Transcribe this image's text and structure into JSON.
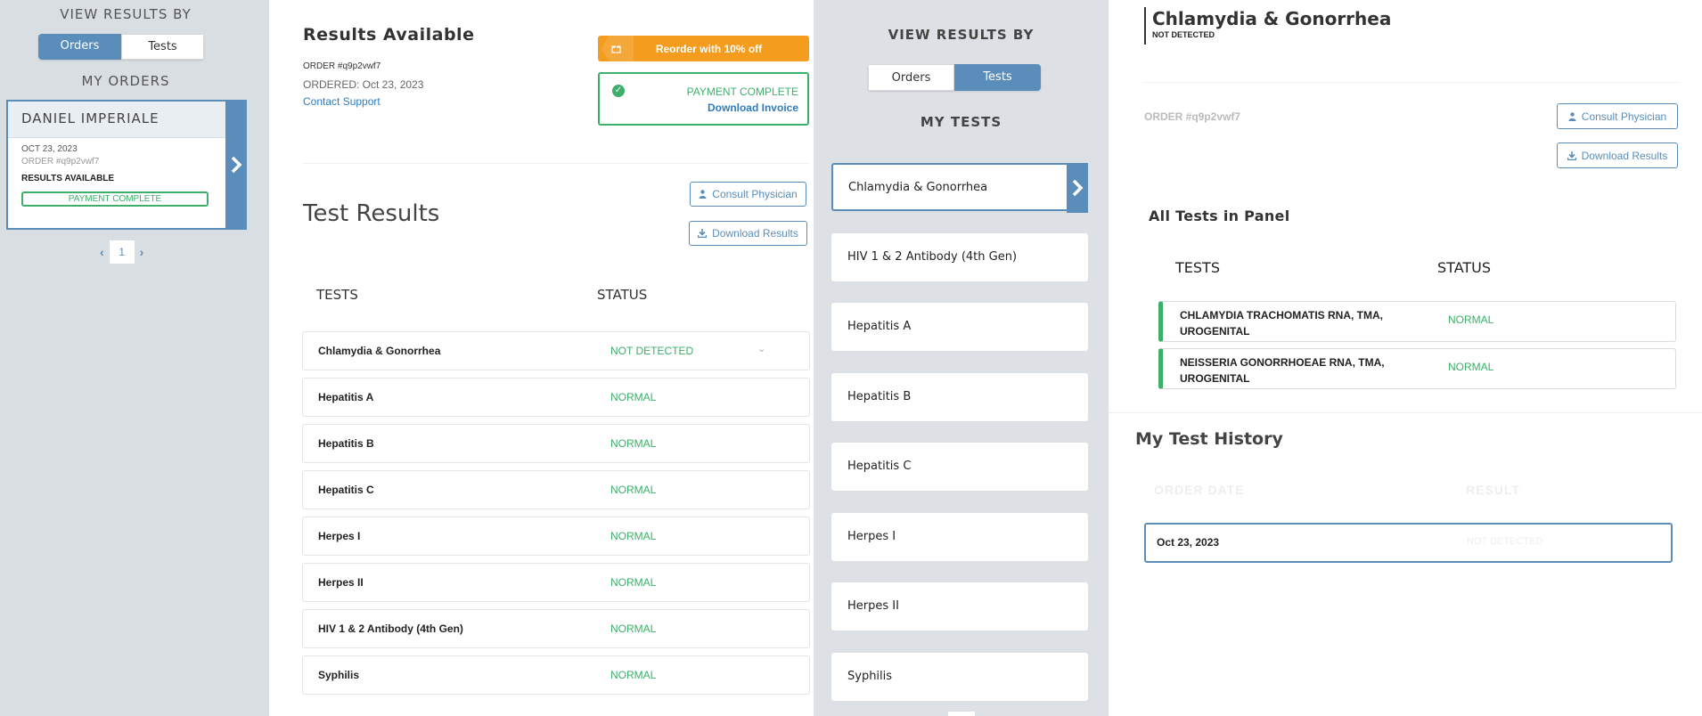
{
  "orders_panel": {
    "view_results_by": "VIEW RESULTS BY",
    "toggle": {
      "orders": "Orders",
      "tests": "Tests"
    },
    "my_orders": "MY ORDERS",
    "order_card": {
      "name": "DANIEL IMPERIALE",
      "date": "OCT 23, 2023",
      "order_number": "ORDER #q9p2vwf7",
      "status": "RESULTS AVAILABLE",
      "payment": "PAYMENT COMPLETE"
    },
    "pager": {
      "page": "1"
    }
  },
  "results_panel": {
    "title": "Results Available",
    "order_number": "ORDER #q9p2vwf7",
    "ordered": "ORDERED: Oct 23, 2023",
    "contact_support": "Contact Support",
    "reorder": "Reorder with 10% off",
    "payment_complete": "PAYMENT COMPLETE",
    "download_invoice": "Download Invoice",
    "test_results_title": "Test Results",
    "consult_physician": "Consult Physician",
    "download_results": "Download Results",
    "col_tests": "TESTS",
    "col_status": "STATUS",
    "rows": [
      {
        "name": "Chlamydia & Gonorrhea",
        "status": "NOT DETECTED"
      },
      {
        "name": "Hepatitis A",
        "status": "NORMAL"
      },
      {
        "name": "Hepatitis B",
        "status": "NORMAL"
      },
      {
        "name": "Hepatitis C",
        "status": "NORMAL"
      },
      {
        "name": "Herpes I",
        "status": "NORMAL"
      },
      {
        "name": "Herpes II",
        "status": "NORMAL"
      },
      {
        "name": "HIV 1 & 2 Antibody (4th Gen)",
        "status": "NORMAL"
      },
      {
        "name": "Syphilis",
        "status": "NORMAL"
      }
    ]
  },
  "tests_panel": {
    "view_results_by": "VIEW RESULTS BY",
    "toggle": {
      "orders": "Orders",
      "tests": "Tests"
    },
    "my_tests": "MY TESTS",
    "items": [
      "Chlamydia & Gonorrhea",
      "HIV 1 & 2 Antibody (4th Gen)",
      "Hepatitis A",
      "Hepatitis B",
      "Hepatitis C",
      "Herpes I",
      "Herpes II",
      "Syphilis"
    ]
  },
  "detail_panel": {
    "title": "Chlamydia & Gonorrhea",
    "subtitle": "NOT DETECTED",
    "order_number": "ORDER #q9p2vwf7",
    "consult_physician": "Consult Physician",
    "download_results": "Download Results",
    "all_tests_title": "All Tests in Panel",
    "col_tests": "TESTS",
    "col_status": "STATUS",
    "panel_rows": [
      {
        "name": "CHLAMYDIA TRACHOMATIS RNA, TMA, UROGENITAL",
        "status": "NORMAL"
      },
      {
        "name": "NEISSERIA GONORRHOEAE RNA, TMA, UROGENITAL",
        "status": "NORMAL"
      }
    ],
    "history_title": "My Test History",
    "history_col_date": "ORDER DATE",
    "history_col_result": "RESULT",
    "history_row": {
      "date": "Oct 23, 2023",
      "result": "NOT DETECTED"
    }
  },
  "colors": {
    "accent": "#5a8db9",
    "success": "#3eae6b",
    "reorder": "#f39c1d",
    "link": "#2f7cc0"
  }
}
